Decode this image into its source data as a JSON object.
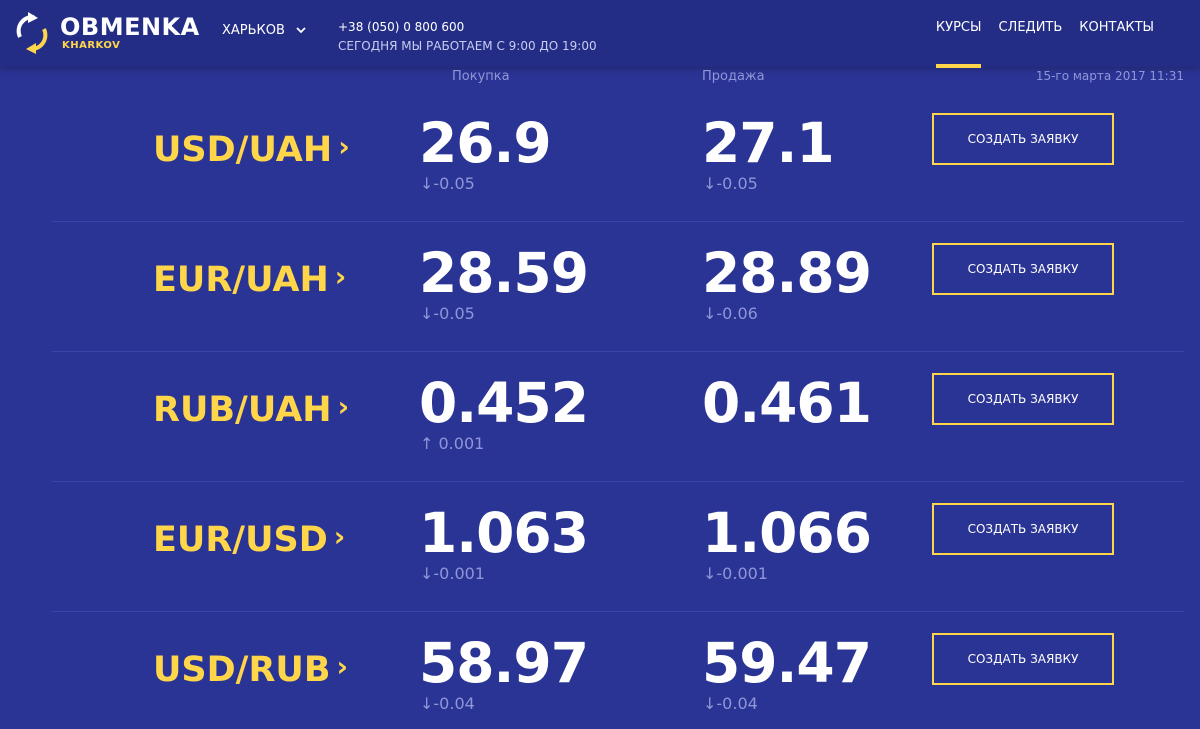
{
  "header": {
    "logo_title": "OBMENKA",
    "logo_sub": "KHARKOV",
    "city": "ХАРЬКОВ",
    "phone": "+38 (050) 0 800 600",
    "hours": "СЕГОДНЯ МЫ РАБОТАЕМ С 9:00 ДО 19:00",
    "nav": [
      "КУРСЫ",
      "СЛЕДИТЬ",
      "КОНТАКТЫ"
    ]
  },
  "columns": {
    "buy": "Покупка",
    "sell": "Продажа",
    "date": "15-го марта 2017 11:31"
  },
  "colors": {
    "bg": "#2a3494",
    "accent": "#ffd54a"
  },
  "rates": [
    {
      "pair": "USD/UAH",
      "buy": "26.9",
      "buy_change": "↓-0.05",
      "sell": "27.1",
      "sell_change": "↓-0.05",
      "button": "СОЗДАТЬ ЗАЯВКУ"
    },
    {
      "pair": "EUR/UAH",
      "buy": "28.59",
      "buy_change": "↓-0.05",
      "sell": "28.89",
      "sell_change": "↓-0.06",
      "button": "СОЗДАТЬ ЗАЯВКУ"
    },
    {
      "pair": "RUB/UAH",
      "buy": "0.452",
      "buy_change": "↑ 0.001",
      "sell": "0.461",
      "sell_change": "",
      "button": "СОЗДАТЬ ЗАЯВКУ"
    },
    {
      "pair": "EUR/USD",
      "buy": "1.063",
      "buy_change": "↓-0.001",
      "sell": "1.066",
      "sell_change": "↓-0.001",
      "button": "СОЗДАТЬ ЗАЯВКУ"
    },
    {
      "pair": "USD/RUB",
      "buy": "58.97",
      "buy_change": "↓-0.04",
      "sell": "59.47",
      "sell_change": "↓-0.04",
      "button": "СОЗДАТЬ ЗАЯВКУ"
    }
  ]
}
